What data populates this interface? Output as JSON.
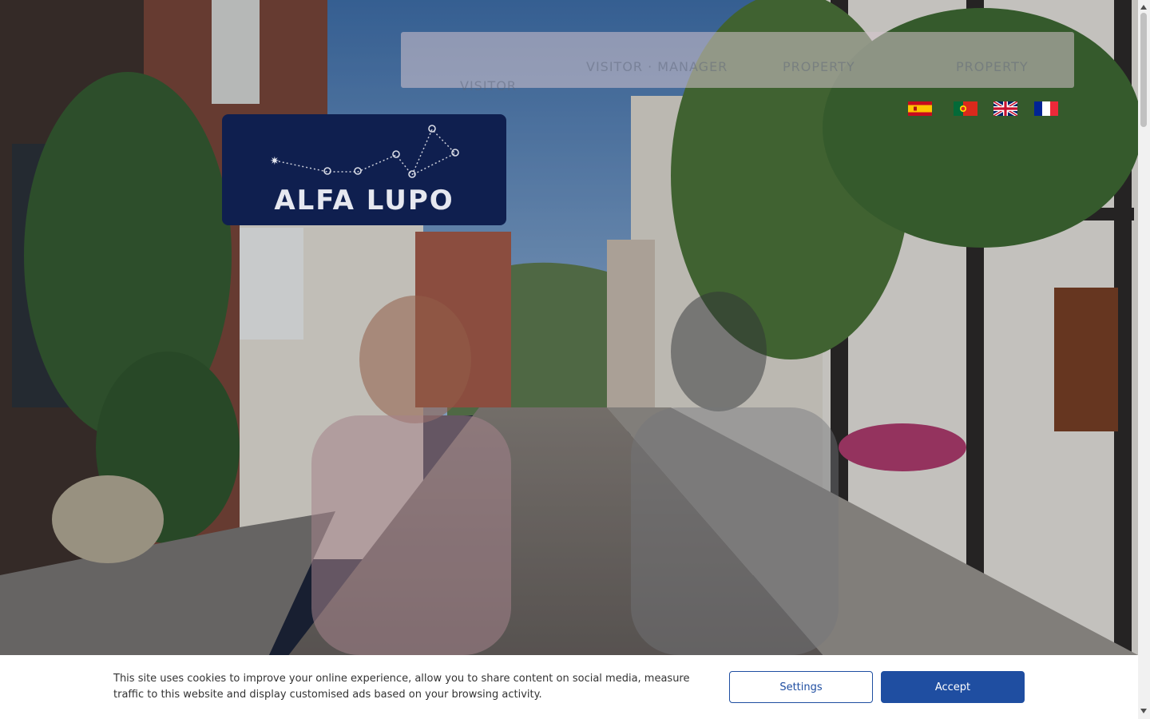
{
  "nav": {
    "items": [
      {
        "label": "VISITOR",
        "icon": null
      },
      {
        "label": "VISITOR · MANAGER",
        "icon": null
      },
      {
        "label": "PROPERTY",
        "icon": null
      },
      {
        "label": "PROPERTY",
        "icon": null
      }
    ]
  },
  "languages": [
    {
      "name": "Español",
      "icon": "spain-flag-icon"
    },
    {
      "name": "Português",
      "icon": "portugal-flag-icon"
    },
    {
      "name": "English",
      "icon": "uk-flag-icon"
    },
    {
      "name": "Français",
      "icon": "france-flag-icon"
    }
  ],
  "logo": {
    "text": "ALFA LUPO",
    "icon": "constellation-icon"
  },
  "cookie": {
    "text": "This site uses cookies to improve your online experience, allow you to share content on social media, measure traffic to this website and display customised ads based on your browsing activity.",
    "settings_label": "Settings",
    "accept_label": "Accept"
  },
  "colors": {
    "logo_bg": "#0f1f4f",
    "accent": "#1f4ea1",
    "banner_bg": "#ffffff"
  }
}
